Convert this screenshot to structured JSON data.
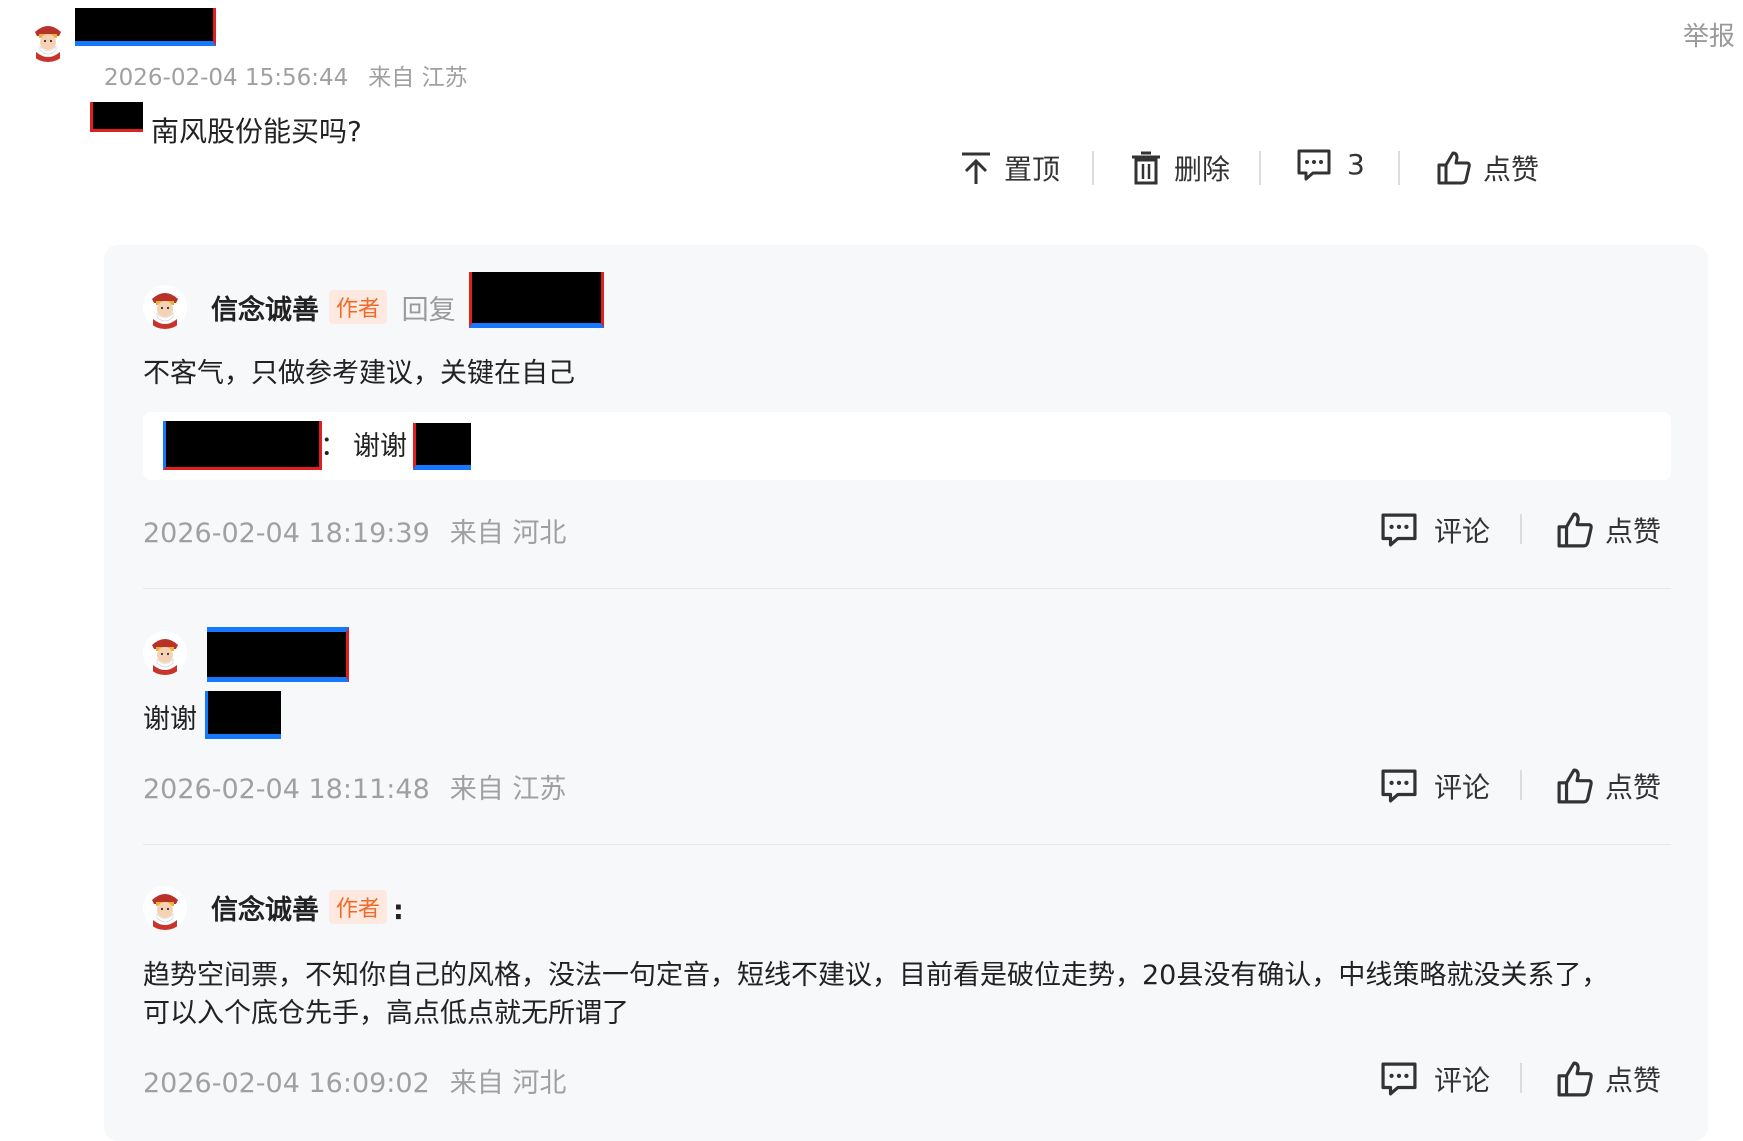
{
  "post": {
    "timestamp": "2026-02-04 15:56:44",
    "location": "来自 江苏",
    "text": "南风股份能买吗?",
    "report_label": "举报",
    "actions": {
      "pin_label": "置顶",
      "delete_label": "删除",
      "comment_count": "3",
      "like_label": "点赞"
    }
  },
  "replies": [
    {
      "author": "信念诚善",
      "author_tag": "作者",
      "reply_verb": "回复",
      "text": "不客气，只做参考建议，关键在自己",
      "quote": {
        "separator": "：",
        "text": "谢谢"
      },
      "timestamp": "2026-02-04 18:19:39",
      "location": "来自 河北",
      "comment_label": "评论",
      "like_label": "点赞"
    },
    {
      "text": "谢谢",
      "timestamp": "2026-02-04 18:11:48",
      "location": "来自 江苏",
      "comment_label": "评论",
      "like_label": "点赞"
    },
    {
      "author": "信念诚善",
      "author_tag": "作者",
      "colon": ":",
      "text_line1": "趋势空间票，不知你自己的风格，没法一句定音，短线不建议，目前看是破位走势，20县没有确认，中线策略就没关系了，",
      "text_line2": "可以入个底仓先手，高点低点就无所谓了",
      "timestamp": "2026-02-04 16:09:02",
      "location": "来自 河北",
      "comment_label": "评论",
      "like_label": "点赞"
    }
  ]
}
